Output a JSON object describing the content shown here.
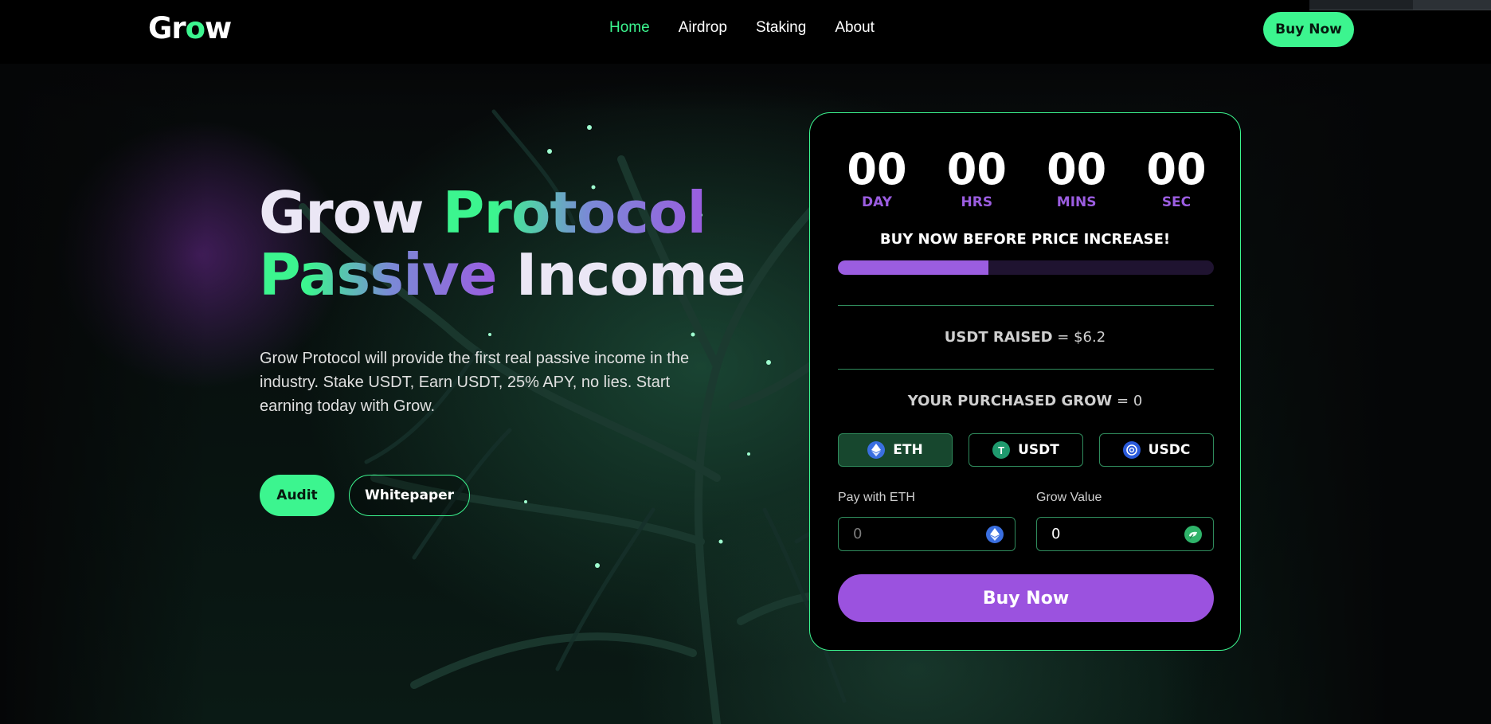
{
  "header": {
    "logo_prefix": "Gr",
    "logo_o": "o",
    "logo_suffix": "w",
    "nav": [
      {
        "label": "Home",
        "active": true
      },
      {
        "label": "Airdrop"
      },
      {
        "label": "Staking"
      },
      {
        "label": "About"
      }
    ],
    "buy_label": "Buy Now"
  },
  "hero": {
    "title_word1": "Grow",
    "title_word2": "Protocol",
    "title_word3": "Passive",
    "title_word4": "Income",
    "description": "Grow Protocol will provide the first real passive income in the industry. Stake USDT, Earn USDT, 25% APY, no lies. Start earning today with Grow.",
    "audit_label": "Audit",
    "whitepaper_label": "Whitepaper"
  },
  "presale": {
    "timer": [
      {
        "value": "00",
        "label": "DAY"
      },
      {
        "value": "00",
        "label": "HRS"
      },
      {
        "value": "00",
        "label": "MINS"
      },
      {
        "value": "00",
        "label": "SEC"
      }
    ],
    "headline": "BUY NOW BEFORE PRICE INCREASE!",
    "progress_fraction": 0.4,
    "raised_label": "USDT RAISED",
    "raised_value": "= $6.2",
    "purchased_label": "YOUR PURCHASED GROW",
    "purchased_value": "= 0",
    "currencies": [
      {
        "label": "ETH",
        "icon": "ethereum-icon",
        "selected": true
      },
      {
        "label": "USDT",
        "icon": "tether-icon"
      },
      {
        "label": "USDC",
        "icon": "usdc-icon"
      }
    ],
    "pay_label": "Pay with ETH",
    "pay_placeholder": "0",
    "grow_label": "Grow Value",
    "grow_value": "0",
    "buy_label": "Buy Now"
  },
  "colors": {
    "accent_green": "#3cf58f",
    "accent_purple": "#9b5de0",
    "background": "#050607"
  }
}
